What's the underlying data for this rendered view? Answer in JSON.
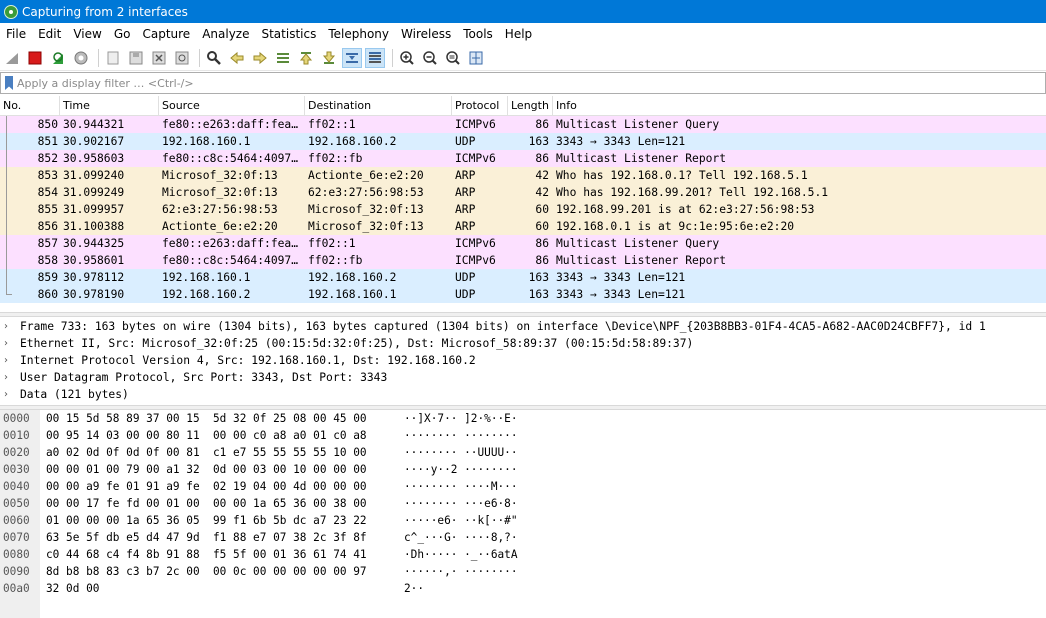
{
  "window": {
    "title": "Capturing from 2 interfaces"
  },
  "menu": [
    "File",
    "Edit",
    "View",
    "Go",
    "Capture",
    "Analyze",
    "Statistics",
    "Telephony",
    "Wireless",
    "Tools",
    "Help"
  ],
  "toolbar": {
    "icons": [
      "shark-fin-start-icon",
      "stop-capture-icon",
      "restart-capture-icon",
      "capture-options-icon",
      "open-file-icon",
      "save-file-icon",
      "close-file-icon",
      "reload-file-icon",
      "find-packet-icon",
      "go-back-icon",
      "go-forward-icon",
      "go-to-packet-icon",
      "go-first-icon",
      "go-last-icon",
      "autoscroll-icon",
      "colorize-icon",
      "zoom-in-icon",
      "zoom-out-icon",
      "zoom-normal-icon",
      "resize-columns-icon"
    ]
  },
  "filter": {
    "placeholder": "Apply a display filter … <Ctrl-/>"
  },
  "packet_list": {
    "columns": [
      "No.",
      "Time",
      "Source",
      "Destination",
      "Protocol",
      "Length",
      "Info"
    ],
    "rows": [
      {
        "no": "850",
        "time": "30.944321",
        "src": "fe80::e263:daff:fea…",
        "dst": "ff02::1",
        "proto": "ICMPv6",
        "len": "86",
        "info": "Multicast Listener Query",
        "color": "#fce0ff"
      },
      {
        "no": "851",
        "time": "30.902167",
        "src": "192.168.160.1",
        "dst": "192.168.160.2",
        "proto": "UDP",
        "len": "163",
        "info": "3343 → 3343 Len=121",
        "color": "#daeeff"
      },
      {
        "no": "852",
        "time": "30.958603",
        "src": "fe80::c8c:5464:4097…",
        "dst": "ff02::fb",
        "proto": "ICMPv6",
        "len": "86",
        "info": "Multicast Listener Report",
        "color": "#fce0ff"
      },
      {
        "no": "853",
        "time": "31.099240",
        "src": "Microsof_32:0f:13",
        "dst": "Actionte_6e:e2:20",
        "proto": "ARP",
        "len": "42",
        "info": "Who has 192.168.0.1? Tell 192.168.5.1",
        "color": "#faf0d7"
      },
      {
        "no": "854",
        "time": "31.099249",
        "src": "Microsof_32:0f:13",
        "dst": "62:e3:27:56:98:53",
        "proto": "ARP",
        "len": "42",
        "info": "Who has 192.168.99.201? Tell 192.168.5.1",
        "color": "#faf0d7"
      },
      {
        "no": "855",
        "time": "31.099957",
        "src": "62:e3:27:56:98:53",
        "dst": "Microsof_32:0f:13",
        "proto": "ARP",
        "len": "60",
        "info": "192.168.99.201 is at 62:e3:27:56:98:53",
        "color": "#faf0d7"
      },
      {
        "no": "856",
        "time": "31.100388",
        "src": "Actionte_6e:e2:20",
        "dst": "Microsof_32:0f:13",
        "proto": "ARP",
        "len": "60",
        "info": "192.168.0.1 is at 9c:1e:95:6e:e2:20",
        "color": "#faf0d7"
      },
      {
        "no": "857",
        "time": "30.944325",
        "src": "fe80::e263:daff:fea…",
        "dst": "ff02::1",
        "proto": "ICMPv6",
        "len": "86",
        "info": "Multicast Listener Query",
        "color": "#fce0ff"
      },
      {
        "no": "858",
        "time": "30.958601",
        "src": "fe80::c8c:5464:4097…",
        "dst": "ff02::fb",
        "proto": "ICMPv6",
        "len": "86",
        "info": "Multicast Listener Report",
        "color": "#fce0ff"
      },
      {
        "no": "859",
        "time": "30.978112",
        "src": "192.168.160.1",
        "dst": "192.168.160.2",
        "proto": "UDP",
        "len": "163",
        "info": "3343 → 3343 Len=121",
        "color": "#daeeff"
      },
      {
        "no": "860",
        "time": "30.978190",
        "src": "192.168.160.2",
        "dst": "192.168.160.1",
        "proto": "UDP",
        "len": "163",
        "info": "3343 → 3343 Len=121",
        "color": "#daeeff"
      }
    ]
  },
  "details": [
    "Frame 733: 163 bytes on wire (1304 bits), 163 bytes captured (1304 bits) on interface \\Device\\NPF_{203B8BB3-01F4-4CA5-A682-AAC0D24CBFF7}, id 1",
    "Ethernet II, Src: Microsof_32:0f:25 (00:15:5d:32:0f:25), Dst: Microsof_58:89:37 (00:15:5d:58:89:37)",
    "Internet Protocol Version 4, Src: 192.168.160.1, Dst: 192.168.160.2",
    "User Datagram Protocol, Src Port: 3343, Dst Port: 3343",
    "Data (121 bytes)"
  ],
  "bytes": [
    {
      "off": "0000",
      "hex": "00 15 5d 58 89 37 00 15  5d 32 0f 25 08 00 45 00",
      "ascii": "··]X·7·· ]2·%··E·"
    },
    {
      "off": "0010",
      "hex": "00 95 14 03 00 00 80 11  00 00 c0 a8 a0 01 c0 a8",
      "ascii": "········ ········"
    },
    {
      "off": "0020",
      "hex": "a0 02 0d 0f 0d 0f 00 81  c1 e7 55 55 55 55 10 00",
      "ascii": "········ ··UUUU··"
    },
    {
      "off": "0030",
      "hex": "00 00 01 00 79 00 a1 32  0d 00 03 00 10 00 00 00",
      "ascii": "····y··2 ········"
    },
    {
      "off": "0040",
      "hex": "00 00 a9 fe 01 91 a9 fe  02 19 04 00 4d 00 00 00",
      "ascii": "········ ····M···"
    },
    {
      "off": "0050",
      "hex": "00 00 17 fe fd 00 01 00  00 00 1a 65 36 00 38 00",
      "ascii": "········ ···e6·8·"
    },
    {
      "off": "0060",
      "hex": "01 00 00 00 1a 65 36 05  99 f1 6b 5b dc a7 23 22",
      "ascii": "·····e6· ··k[··#\""
    },
    {
      "off": "0070",
      "hex": "63 5e 5f db e5 d4 47 9d  f1 88 e7 07 38 2c 3f 8f",
      "ascii": "c^_···G· ····8,?·"
    },
    {
      "off": "0080",
      "hex": "c0 44 68 c4 f4 8b 91 88  f5 5f 00 01 36 61 74 41",
      "ascii": "·Dh····· ·_··6atA"
    },
    {
      "off": "0090",
      "hex": "8d b8 b8 83 c3 b7 2c 00  00 0c 00 00 00 00 00 97",
      "ascii": "······,· ········"
    },
    {
      "off": "00a0",
      "hex": "32 0d 00",
      "ascii": "2··"
    }
  ]
}
